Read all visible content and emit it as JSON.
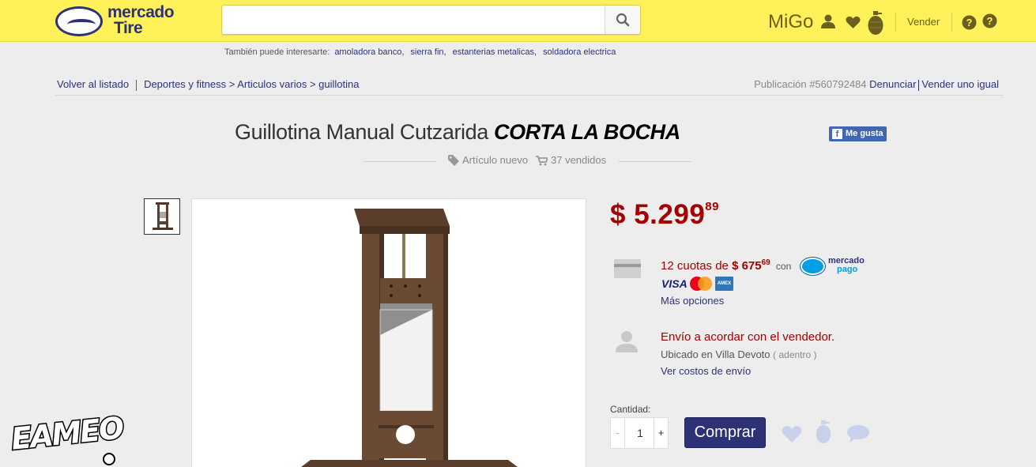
{
  "header": {
    "logo_line1": "mercado",
    "logo_line2": "Tire",
    "search_placeholder": "",
    "user": "MiGo",
    "sell_label": "Vender",
    "icons": [
      "user-icon",
      "heart-icon",
      "grenade-icon",
      "help-icon",
      "notification-icon"
    ]
  },
  "suggestions": {
    "label": "También puede interesarte:",
    "items": [
      "amoladora banco,",
      "sierra fin,",
      "estanterias metalicas,",
      "soldadora electrica"
    ]
  },
  "breadcrumb": {
    "back": "Volver al listado",
    "path": "Deportes y fitness > Articulos varios > guillotina"
  },
  "publication": {
    "id_text": "Publicación #560792484",
    "report": "Denunciar",
    "sell_same": "Vender uno igual"
  },
  "product": {
    "title_regular": "Guillotina Manual Cutzarida",
    "title_bold": "CORTA LA BOCHA",
    "like_label": "Me gusta",
    "condition": "Artículo nuevo",
    "sold": "37 vendidos"
  },
  "price": {
    "currency": "$",
    "integer": "5.299",
    "decimals": "89"
  },
  "payment": {
    "installments_text": "12 cuotas de",
    "installment_amount": "$ 675",
    "installment_decimals": "69",
    "with": "con",
    "provider_line1": "mercado",
    "provider_line2": "pago",
    "card_visa": "VISA",
    "card_amex": "AMEX",
    "more_options": "Más opciones"
  },
  "shipping": {
    "text": "Envío a acordar con el vendedor.",
    "location": "Ubicado en Villa Devoto",
    "zone": "( adentro )",
    "costs_link": "Ver costos de envío"
  },
  "purchase": {
    "quantity_label": "Cantidad:",
    "quantity": "1",
    "minus": "-",
    "plus": "+",
    "buy_label": "Comprar"
  },
  "watermark": "EAMEO",
  "colors": {
    "header_bg": "#fff159",
    "brand_blue": "#2d3277",
    "price_red": "#a50000",
    "page_bg": "#ededed"
  }
}
